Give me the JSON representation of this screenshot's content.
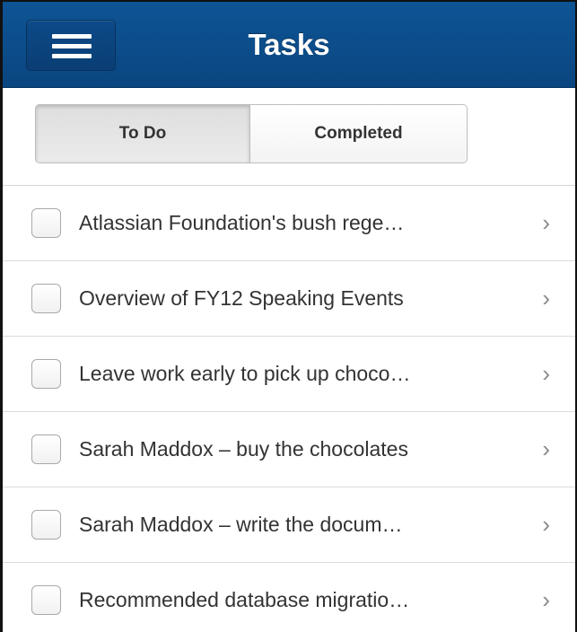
{
  "header": {
    "title": "Tasks",
    "menu_icon": "hamburger-menu-icon"
  },
  "tabs": [
    {
      "label": "To Do",
      "selected": true
    },
    {
      "label": "Completed",
      "selected": false
    }
  ],
  "tasks": [
    {
      "label": "Atlassian Foundation's bush rege…",
      "checked": false
    },
    {
      "label": "Overview of FY12 Speaking Events",
      "checked": false
    },
    {
      "label": "Leave work early to pick up choco…",
      "checked": false
    },
    {
      "label": "Sarah Maddox – buy the chocolates",
      "checked": false
    },
    {
      "label": "Sarah Maddox – write the docum…",
      "checked": false
    },
    {
      "label": "Recommended database migratio…",
      "checked": false
    }
  ],
  "row_chevron": "›",
  "colors": {
    "header_bg": "#0a4680",
    "accent_text": "#ffffff"
  }
}
